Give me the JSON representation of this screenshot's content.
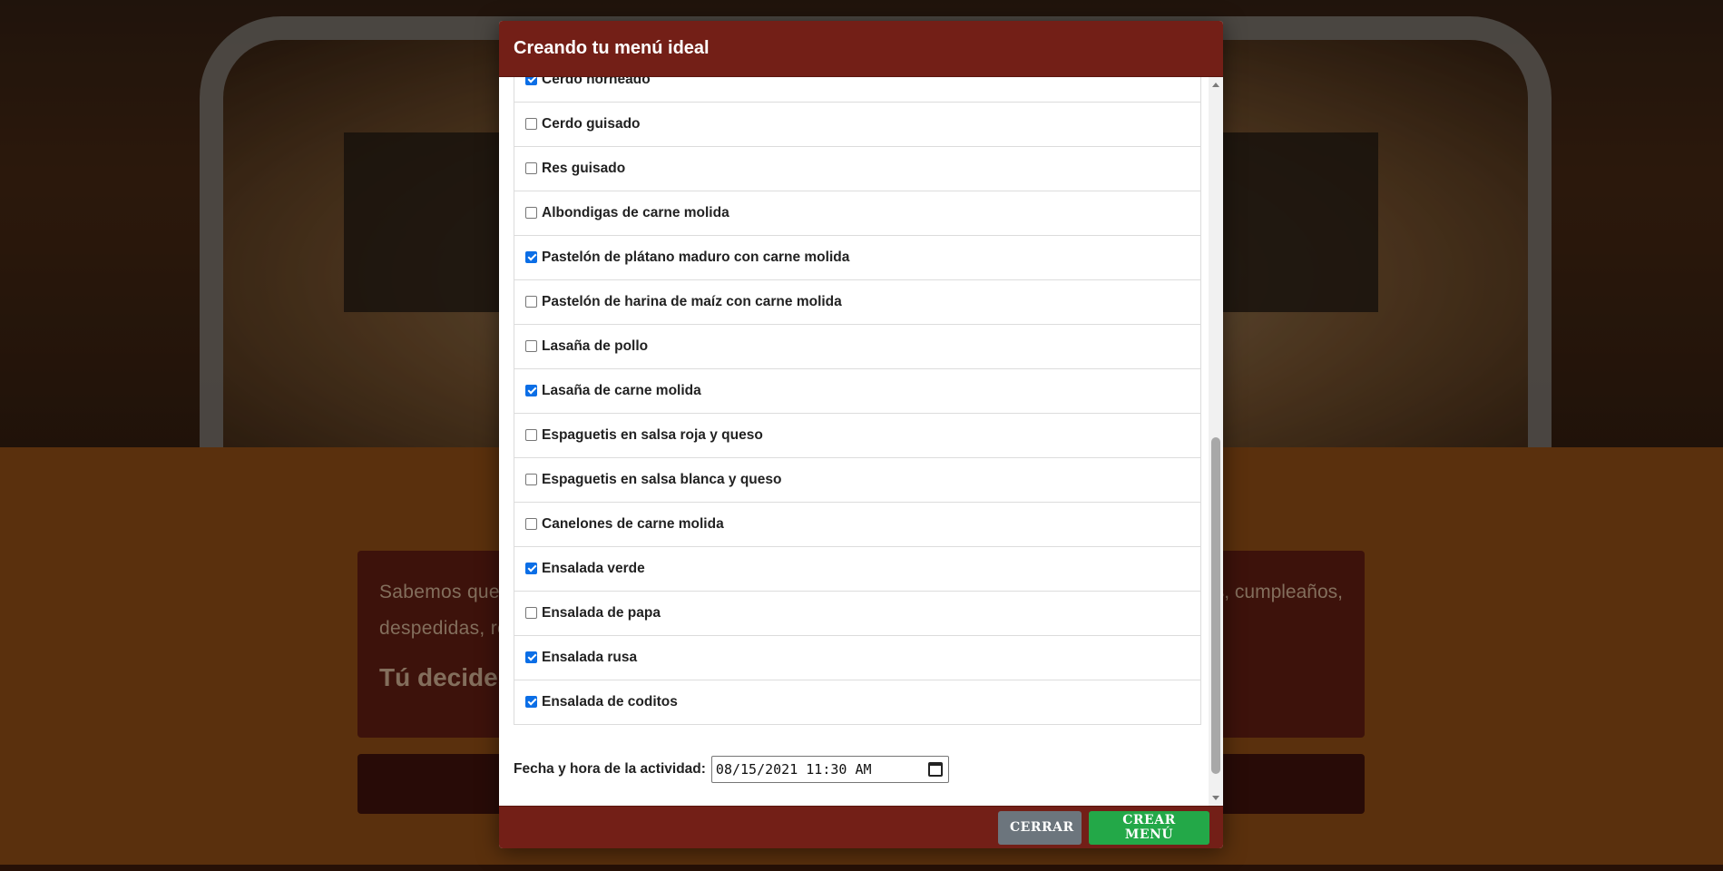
{
  "background": {
    "intro_text_line1": "Sabemos que p",
    "intro_text_right": "s, cumpleaños,",
    "intro_text_line2": "despedidas, re",
    "tu_decides": "Tú decides"
  },
  "modal": {
    "title": "Creando tu menú ideal",
    "items": [
      {
        "label": "Cerdo horneado",
        "checked": true
      },
      {
        "label": "Cerdo guisado",
        "checked": false
      },
      {
        "label": "Res guisado",
        "checked": false
      },
      {
        "label": "Albondigas de carne molida",
        "checked": false
      },
      {
        "label": "Pastelón de plátano maduro con carne molida",
        "checked": true
      },
      {
        "label": "Pastelón de harina de maíz con carne molida",
        "checked": false
      },
      {
        "label": "Lasaña de pollo",
        "checked": false
      },
      {
        "label": "Lasaña de carne molida",
        "checked": true
      },
      {
        "label": "Espaguetis en salsa roja y queso",
        "checked": false
      },
      {
        "label": "Espaguetis en salsa blanca y queso",
        "checked": false
      },
      {
        "label": "Canelones de carne molida",
        "checked": false
      },
      {
        "label": "Ensalada verde",
        "checked": true
      },
      {
        "label": "Ensalada de papa",
        "checked": false
      },
      {
        "label": "Ensalada rusa",
        "checked": true
      },
      {
        "label": "Ensalada de coditos",
        "checked": true
      }
    ],
    "date_label": "Fecha y hora de la actividad:",
    "date_value": "08/15/2021 11:30 AM",
    "close_button": "CERRAR",
    "create_button": "CREAR MENÚ"
  },
  "colors": {
    "header_bg": "#731f17",
    "checkbox_checked": "#0b6ee6",
    "close_btn": "#6c757d",
    "create_btn": "#23a848"
  }
}
